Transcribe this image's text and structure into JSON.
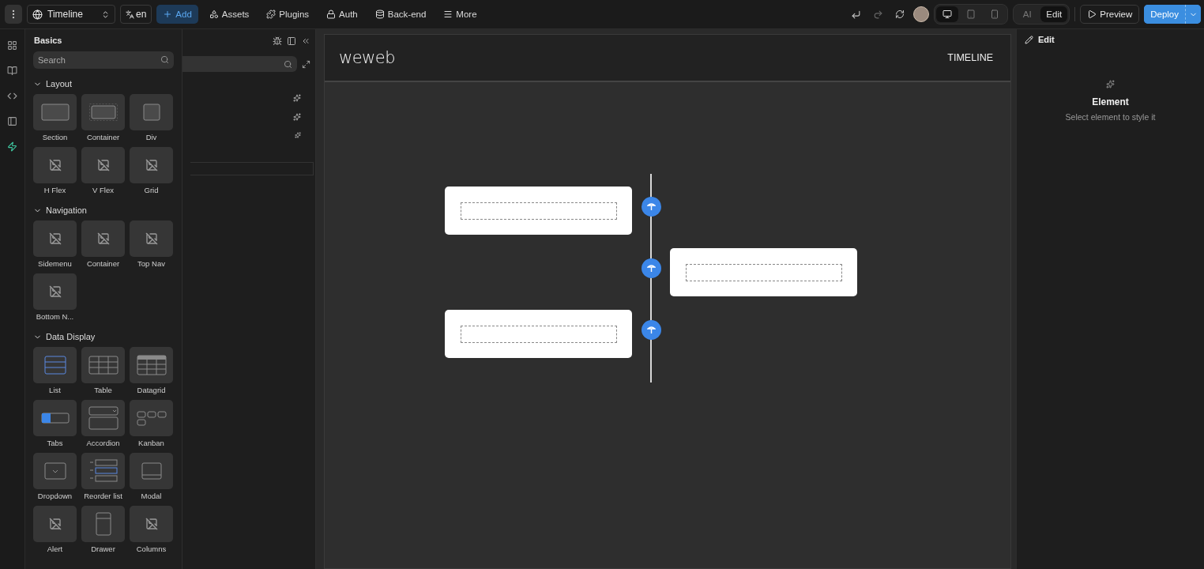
{
  "topbar": {
    "page_selector": "Timeline",
    "language": "en",
    "nav": [
      {
        "kind": "add",
        "label": "Add"
      },
      {
        "kind": "assets",
        "label": "Assets"
      },
      {
        "kind": "plugins",
        "label": "Plugins"
      },
      {
        "kind": "auth",
        "label": "Auth"
      },
      {
        "kind": "backend",
        "label": "Back-end"
      },
      {
        "kind": "more",
        "label": "More"
      }
    ],
    "devices": [
      {
        "kind": "desktop",
        "selected": true
      },
      {
        "kind": "tablet",
        "selected": false
      },
      {
        "kind": "mobile",
        "selected": false
      }
    ],
    "modes": [
      {
        "label": "AI",
        "selected": false
      },
      {
        "label": "Edit",
        "selected": true
      }
    ],
    "preview": "Preview",
    "deploy": "Deploy"
  },
  "rail": [
    {
      "kind": "elements",
      "selected": false
    },
    {
      "kind": "library",
      "selected": false
    },
    {
      "kind": "code",
      "selected": false
    },
    {
      "kind": "layout",
      "selected": false
    },
    {
      "kind": "logic",
      "selected": true
    }
  ],
  "basics": {
    "title": "Basics",
    "search": {
      "placeholder": "Search"
    },
    "sections": [
      {
        "title": "Layout",
        "expanded": true,
        "items": [
          {
            "kind": "section",
            "label": "Section"
          },
          {
            "kind": "container",
            "label": "Container"
          },
          {
            "kind": "div",
            "label": "Div"
          },
          {
            "kind": "image",
            "label": "H Flex"
          },
          {
            "kind": "image",
            "label": "V Flex"
          },
          {
            "kind": "image",
            "label": "Grid"
          }
        ]
      },
      {
        "title": "Navigation",
        "expanded": true,
        "items": [
          {
            "kind": "image",
            "label": "Sidemenu"
          },
          {
            "kind": "image",
            "label": "Container"
          },
          {
            "kind": "image",
            "label": "Top Nav"
          },
          {
            "kind": "image",
            "label": "Bottom N..."
          }
        ]
      },
      {
        "title": "Data Display",
        "expanded": true,
        "items": [
          {
            "kind": "list",
            "label": "List"
          },
          {
            "kind": "table",
            "label": "Table"
          },
          {
            "kind": "datagrid",
            "label": "Datagrid"
          },
          {
            "kind": "tabs",
            "label": "Tabs"
          },
          {
            "kind": "accordion",
            "label": "Accordion"
          },
          {
            "kind": "kanban",
            "label": "Kanban"
          },
          {
            "kind": "dropdown",
            "label": "Dropdown"
          },
          {
            "kind": "reorder",
            "label": "Reorder list"
          },
          {
            "kind": "modal",
            "label": "Modal"
          },
          {
            "kind": "image",
            "label": "Alert"
          },
          {
            "kind": "drawer",
            "label": "Drawer"
          },
          {
            "kind": "image",
            "label": "Columns"
          }
        ]
      }
    ]
  },
  "canvas": {
    "logo": "weweb",
    "nav_link": "TIMELINE",
    "timeline": [
      {
        "kind": "left"
      },
      {
        "kind": "right"
      },
      {
        "kind": "left"
      }
    ]
  },
  "inspector": {
    "tab": "Edit",
    "title": "Element",
    "hint": "Select element to style it"
  }
}
